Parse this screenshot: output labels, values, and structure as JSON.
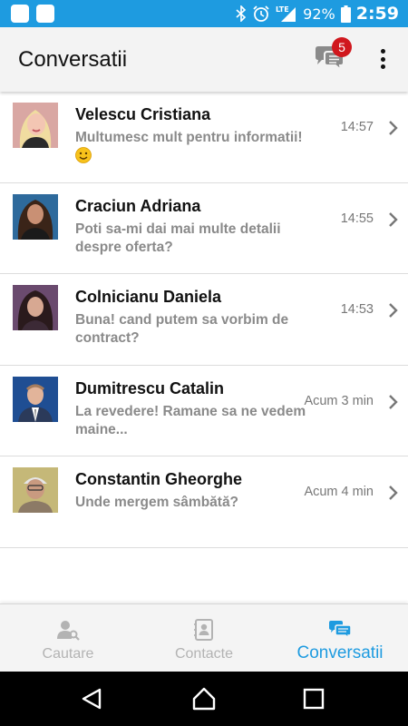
{
  "status_bar": {
    "battery": "92%",
    "time": "2:59",
    "network": "LTE",
    "icons": [
      "bluetooth-icon",
      "alarm-icon",
      "signal-icon",
      "battery-icon"
    ]
  },
  "app_bar": {
    "title": "Conversatii",
    "badge_count": "5",
    "icons": [
      "chat-bubbles-icon",
      "more-vert-icon"
    ]
  },
  "conversations": [
    {
      "name": "Velescu Cristiana",
      "message": "Multumesc mult pentru informatii!",
      "emoji": "smiley-emoji",
      "time": "14:57",
      "avatar": "blonde-woman"
    },
    {
      "name": "Craciun Adriana",
      "message": "Poti sa-mi dai mai multe detalii despre oferta?",
      "time": "14:55",
      "avatar": "dark-hair-woman"
    },
    {
      "name": "Colnicianu Daniela",
      "message": "Buna! cand putem sa vorbim de contract?",
      "time": "14:53",
      "avatar": "brunette-woman"
    },
    {
      "name": "Dumitrescu Catalin",
      "message": "La revedere! Ramane sa ne vedem maine...",
      "time": "Acum 3 min",
      "avatar": "man-in-suit"
    },
    {
      "name": "Constantin Gheorghe",
      "message": "Unde mergem sâmbătă?",
      "time": "Acum 4 min",
      "avatar": "older-man"
    }
  ],
  "bottom_nav": {
    "items": [
      {
        "label": "Cautare",
        "icon": "person-search-icon",
        "active": false
      },
      {
        "label": "Contacte",
        "icon": "contact-book-icon",
        "active": false
      },
      {
        "label": "Conversatii",
        "icon": "chat-bubbles-icon",
        "active": true
      }
    ]
  },
  "colors": {
    "accent": "#1e9be0",
    "badge": "#d0171d",
    "inactive": "#b3b3b3",
    "message_text": "#8a8a8a"
  },
  "system_nav": [
    "back-icon",
    "home-icon",
    "recents-icon"
  ]
}
